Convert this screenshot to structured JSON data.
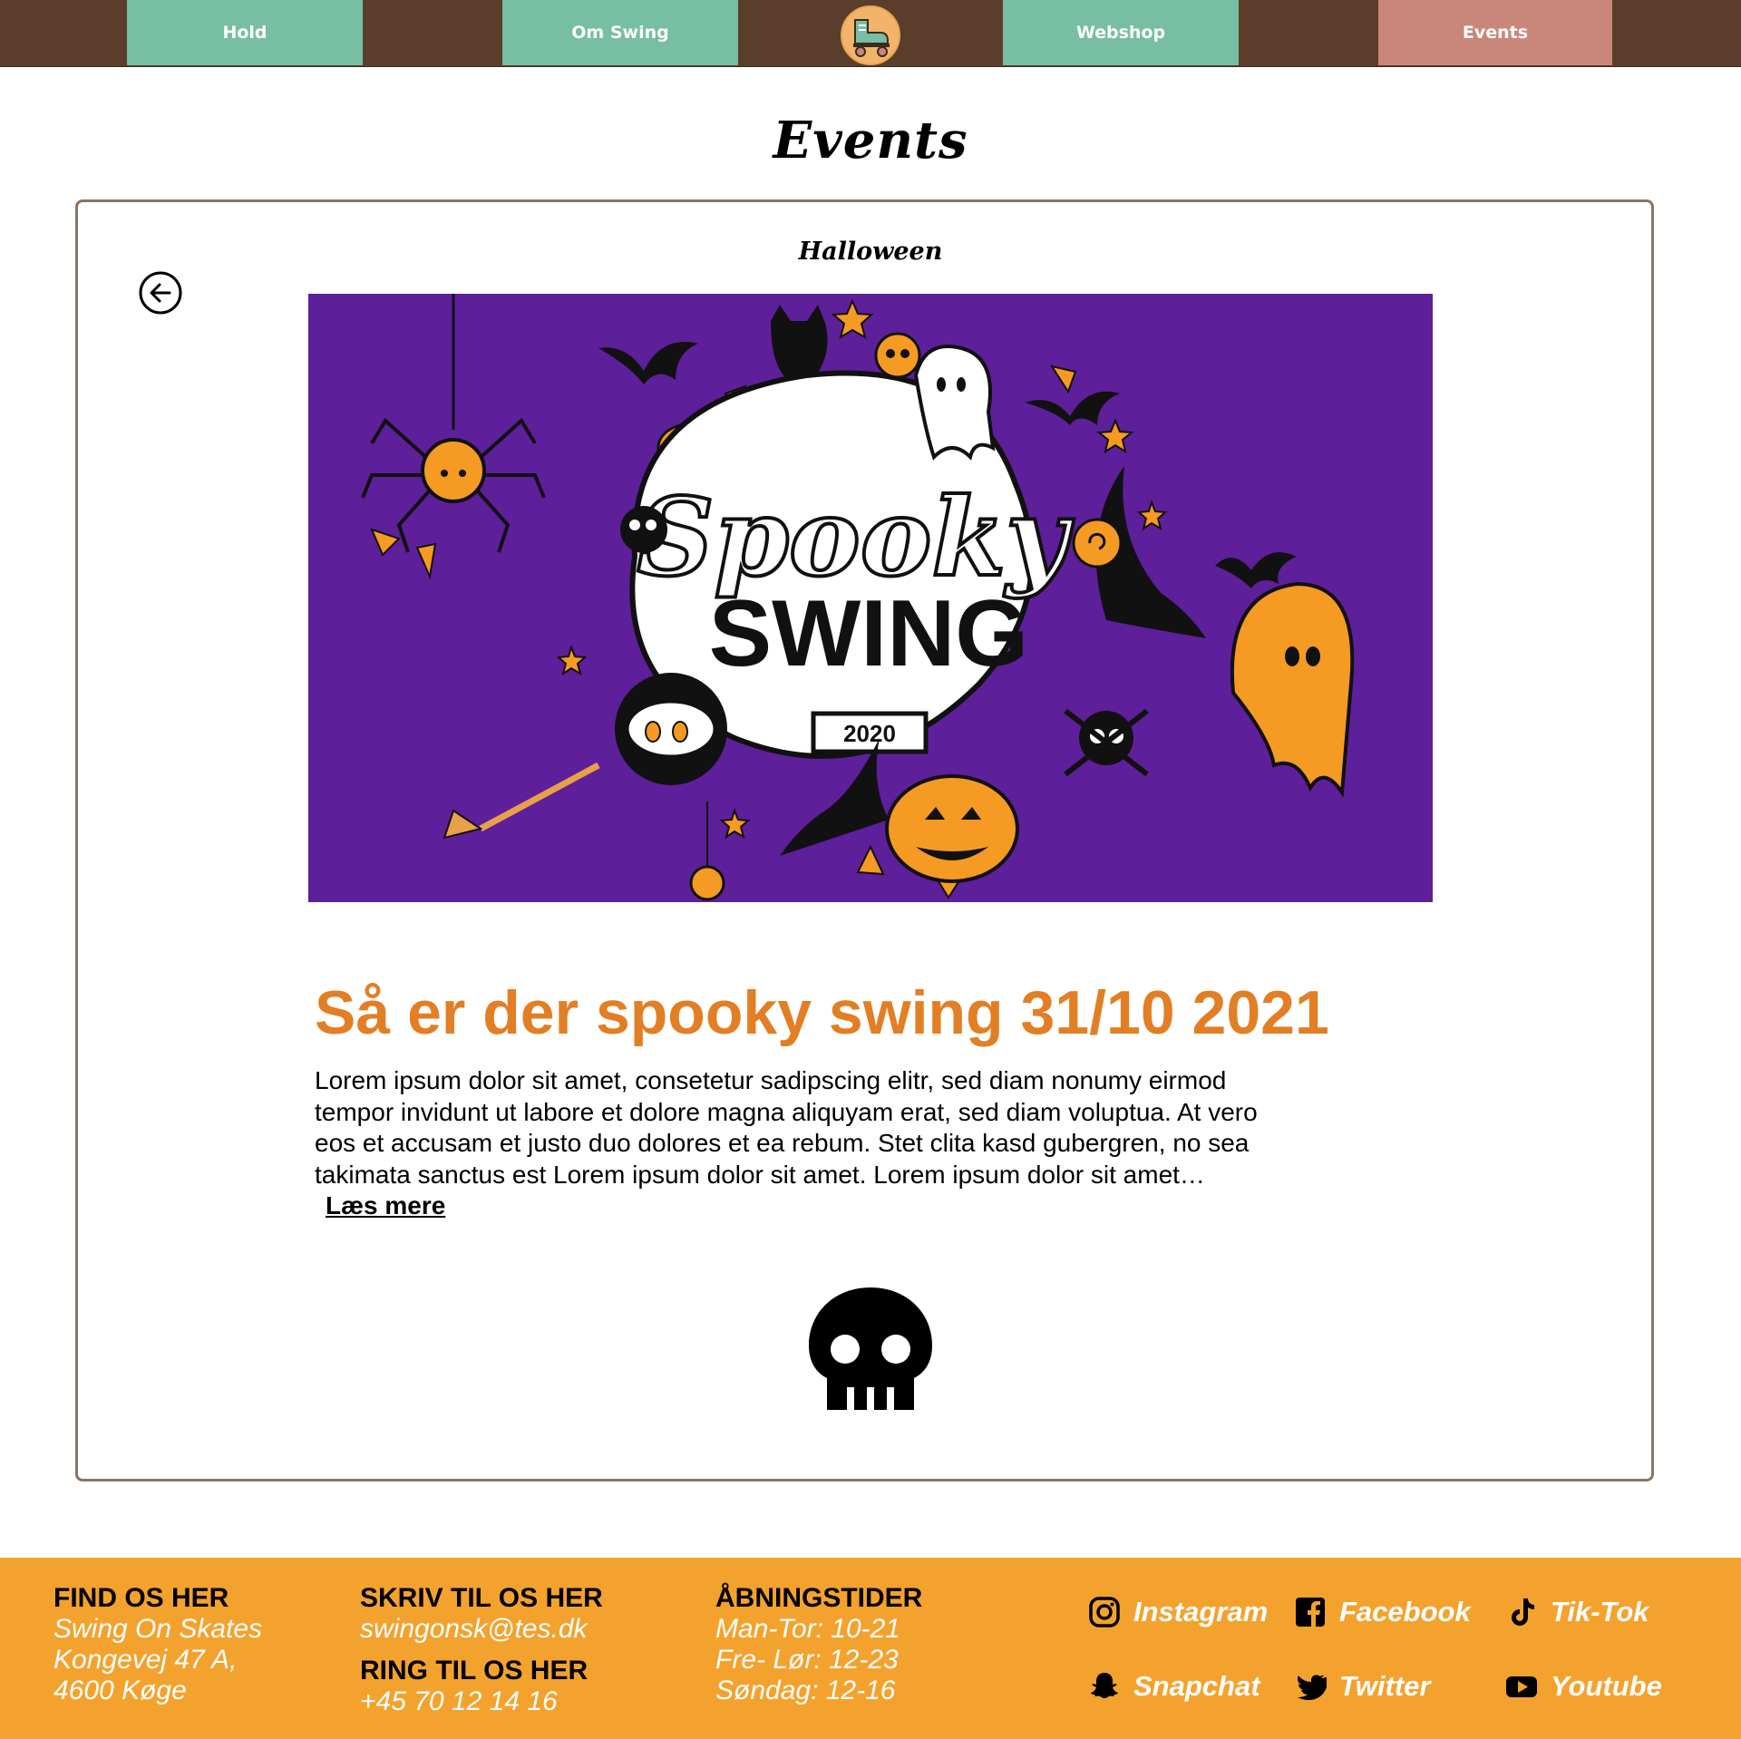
{
  "nav": {
    "items": [
      {
        "label": "Hold"
      },
      {
        "label": "Om Swing"
      },
      {
        "label": "Webshop"
      },
      {
        "label": "Events"
      }
    ]
  },
  "page": {
    "title": "Events"
  },
  "event": {
    "name": "Halloween",
    "banner": {
      "script_word": "Spooky",
      "main_word": "SWING",
      "year": "2020"
    },
    "heading": "Så er der spooky swing 31/10 2021",
    "body": "Lorem ipsum dolor sit amet, consetetur sadipscing elitr, sed diam nonumy eirmod tempor invidunt ut labore et dolore magna aliquyam erat, sed diam voluptua. At vero eos et accusam et justo duo dolores et ea rebum. Stet clita kasd gubergren, no sea takimata sanctus est Lorem ipsum dolor sit amet. Lorem ipsum dolor sit amet…",
    "read_more": "Læs mere"
  },
  "footer": {
    "find_us": {
      "heading": "FIND OS HER",
      "lines": [
        "Swing On Skates",
        "Kongevej 47 A,",
        "4600 Køge"
      ]
    },
    "write_us": {
      "heading": "SKRIV TIL OS HER",
      "email": "swingonsk@tes.dk"
    },
    "call_us": {
      "heading": "RING TIL OS HER",
      "phone": "+45 70 12 14 16"
    },
    "hours": {
      "heading": "ÅBNINGSTIDER",
      "lines": [
        "Man-Tor: 10-21",
        "Fre- Lør: 12-23",
        "Søndag: 12-16"
      ]
    },
    "social": [
      {
        "label": "Instagram",
        "icon": "instagram-icon"
      },
      {
        "label": "Facebook",
        "icon": "facebook-icon"
      },
      {
        "label": "Tik-Tok",
        "icon": "tiktok-icon"
      },
      {
        "label": "Snapchat",
        "icon": "snapchat-icon"
      },
      {
        "label": "Twitter",
        "icon": "twitter-icon"
      },
      {
        "label": "Youtube",
        "icon": "youtube-icon"
      }
    ]
  },
  "colors": {
    "nav_bg": "#5a3e2b",
    "nav_item": "#77bea3",
    "nav_active": "#c8877a",
    "accent_orange": "#e27f24",
    "footer_bg": "#f4a22e",
    "banner_purple": "#5e1f9b",
    "card_border": "#8a7565"
  }
}
